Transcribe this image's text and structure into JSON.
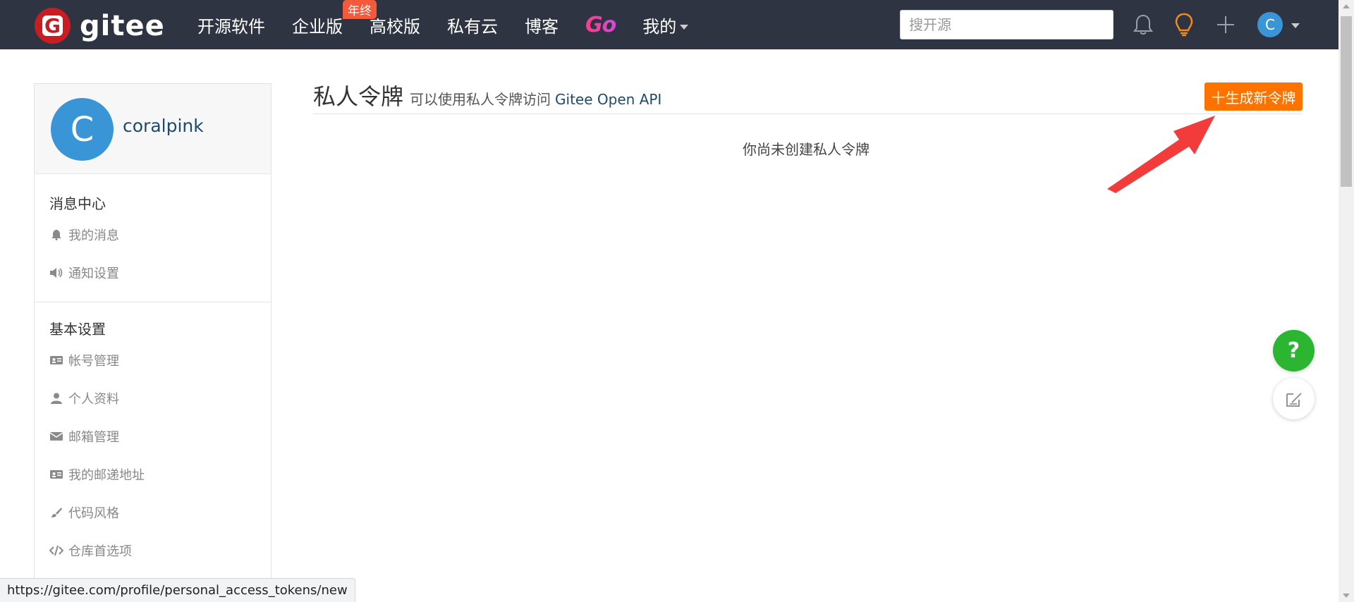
{
  "nav": {
    "logo_text": "gitee",
    "items": [
      {
        "label": "开源软件"
      },
      {
        "label": "企业版",
        "badge": "年终"
      },
      {
        "label": "高校版"
      },
      {
        "label": "私有云"
      },
      {
        "label": "博客"
      },
      {
        "label": "Go"
      },
      {
        "label": "我的"
      }
    ],
    "search_placeholder": "搜开源",
    "avatar_letter": "C",
    "icons": [
      "bell-icon",
      "lightbulb-icon",
      "plus-icon"
    ]
  },
  "sidebar": {
    "avatar_letter": "C",
    "username": "coralpink",
    "groups": [
      {
        "title": "消息中心",
        "items": [
          {
            "label": "我的消息",
            "icon": "bell-icon"
          },
          {
            "label": "通知设置",
            "icon": "speaker-icon"
          }
        ]
      },
      {
        "title": "基本设置",
        "items": [
          {
            "label": "帐号管理",
            "icon": "id-card-icon"
          },
          {
            "label": "个人资料",
            "icon": "user-icon"
          },
          {
            "label": "邮箱管理",
            "icon": "envelope-icon"
          },
          {
            "label": "我的邮递地址",
            "icon": "id-card-icon"
          },
          {
            "label": "代码风格",
            "icon": "brush-icon"
          },
          {
            "label": "仓库首选项",
            "icon": "code-icon"
          }
        ]
      }
    ]
  },
  "main": {
    "title": "私人令牌",
    "subtitle": "可以使用私人令牌访问",
    "api_link": "Gitee Open API",
    "new_button": "十生成新令牌",
    "empty_message": "你尚未创建私人令牌"
  },
  "fab": {
    "help": "?"
  },
  "status_url": "https://gitee.com/profile/personal_access_tokens/new",
  "colors": {
    "nav_bg": "#2e3441",
    "brand_red": "#c71d23",
    "accent_orange": "#fe7300",
    "link_blue": "#1f4a6b",
    "help_green": "#2bb531"
  }
}
